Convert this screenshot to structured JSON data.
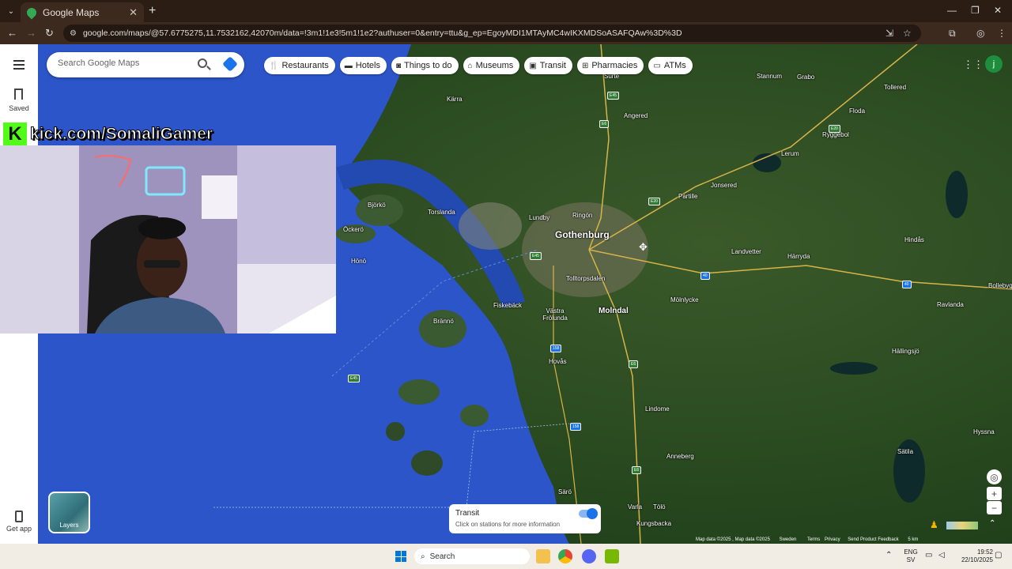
{
  "browser": {
    "tab_title": "Google Maps",
    "url": "google.com/maps/@57.6775275,11.7532162,42070m/data=!3m1!1e3!5m1!1e2?authuser=0&entry=ttu&g_ep=EgoyMDI1MTAyMC4wIKXMDSoASAFQAw%3D%3D",
    "profile_letter": "V"
  },
  "maps": {
    "search_placeholder": "Search Google Maps",
    "saved_label": "Saved",
    "get_app_label": "Get app",
    "layers_label": "Layers",
    "account_letter": "j",
    "chips": [
      {
        "label": "Restaurants",
        "icon": "fork-knife-icon"
      },
      {
        "label": "Hotels",
        "icon": "bed-icon"
      },
      {
        "label": "Things to do",
        "icon": "camera-icon"
      },
      {
        "label": "Museums",
        "icon": "museum-icon"
      },
      {
        "label": "Transit",
        "icon": "train-icon"
      },
      {
        "label": "Pharmacies",
        "icon": "pharmacy-icon"
      },
      {
        "label": "ATMs",
        "icon": "atm-icon"
      }
    ],
    "transit_card": {
      "title": "Transit",
      "subtitle": "Click on stations for more information"
    },
    "places": {
      "gothenburg": "Gothenburg",
      "molndal": "Molndal",
      "surte": "Surte",
      "angered": "Angered",
      "stannum": "Stannum",
      "grabo": "Grabo",
      "tollered": "Tollered",
      "floda": "Floda",
      "ryggebol": "Ryggebol",
      "lerum": "Lerum",
      "jonsered": "Jonsered",
      "partille": "Partille",
      "hindas": "Hindås",
      "landvetter": "Landvetter",
      "harryda": "Härryda",
      "bollebygd": "Bollebyg",
      "ravlanda": "Ravlanda",
      "hallingsjo": "Hällingsjö",
      "bjorko": "Björkö",
      "torslanda": "Torslanda",
      "lundby": "Lundby",
      "ringon": "Ringön",
      "ockero": "Öckerö",
      "hono": "Hönö",
      "tolltorpsdalen": "Tolltorpsdalen",
      "fiskeback": "Fiskebäck",
      "vastra_frolunda": "Västra Frölunda",
      "molnlycke": "Mölnlycke",
      "branno": "Brännö",
      "hovas": "Hovås",
      "lindome": "Lindome",
      "anneberg": "Anneberg",
      "hyssna": "Hyssna",
      "satila": "Sätila",
      "saro": "Särö",
      "varla": "Varla",
      "tolo": "Tölö",
      "kungsbacka": "Kungsbacka",
      "karra": "Kärra"
    },
    "roads": {
      "e45_a": "E45",
      "e45_b": "E45",
      "e45_c": "E45",
      "e6_a": "E6",
      "e6_b": "E6",
      "e6_c": "E6",
      "e20": "E20",
      "r40_a": "40",
      "r40_b": "40",
      "r158_a": "158",
      "r158_b": "158",
      "e20_b": "E20"
    },
    "footer": {
      "map_data": "Map data ©2025 , Map data ©2025",
      "sweden": "Sweden",
      "terms": "Terms",
      "privacy": "Privacy",
      "feedback": "Send Product Feedback",
      "scale": "5 km"
    }
  },
  "overlay": {
    "kick_text": "kick.com/SomaliGamer",
    "kick_logo_letter": "K"
  },
  "taskbar": {
    "search_label": "Search",
    "lang_top": "ENG",
    "lang_bottom": "SV",
    "time": "19:52",
    "date": "22/10/2025"
  }
}
